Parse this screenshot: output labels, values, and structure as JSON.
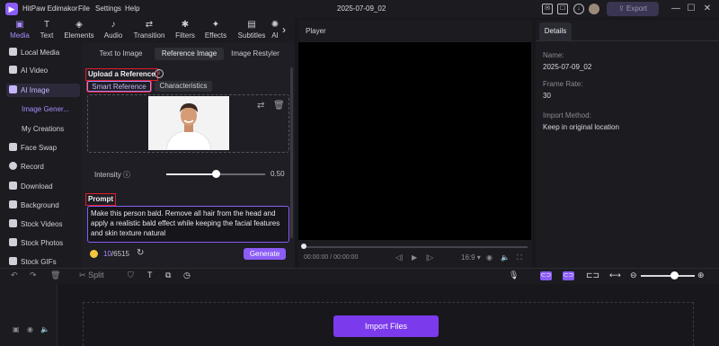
{
  "app": {
    "title": "HitPaw Edimakor",
    "menus": [
      "File",
      "Settings",
      "Help"
    ],
    "project_name": "2025-07-09_02",
    "export_label": "Export"
  },
  "toolbar": {
    "tools": [
      {
        "label": "Media",
        "icon": "media-icon"
      },
      {
        "label": "Text",
        "icon": "text-icon"
      },
      {
        "label": "Elements",
        "icon": "elements-icon"
      },
      {
        "label": "Audio",
        "icon": "audio-icon"
      },
      {
        "label": "Transition",
        "icon": "transition-icon"
      },
      {
        "label": "Filters",
        "icon": "filters-icon"
      },
      {
        "label": "Effects",
        "icon": "effects-icon"
      },
      {
        "label": "Subtitles",
        "icon": "subtitles-icon"
      },
      {
        "label": "AI",
        "icon": "ai-icon"
      }
    ]
  },
  "sidebar": {
    "items": [
      {
        "label": "Local Media"
      },
      {
        "label": "AI Video"
      },
      {
        "label": "AI Image"
      },
      {
        "label": "Face Swap"
      },
      {
        "label": "Record"
      },
      {
        "label": "Download"
      },
      {
        "label": "Background"
      },
      {
        "label": "Stock Videos"
      },
      {
        "label": "Stock Photos"
      },
      {
        "label": "Stock GIFs"
      }
    ],
    "sub_items": [
      {
        "label": "Image Gener..."
      },
      {
        "label": "My Creations"
      }
    ]
  },
  "panel": {
    "tabs": [
      "Text to Image",
      "Reference Image",
      "Image Restyler"
    ],
    "upload_title": "Upload a Reference",
    "chips": [
      "Smart Reference",
      "Characteristics"
    ],
    "intensity_label": "Intensity",
    "intensity_value": "0.50",
    "intensity_fraction": 0.5,
    "prompt_title": "Prompt",
    "prompt_text": "Make this person bald. Remove all hair from the head and apply a realistic bald effect while keeping the facial features and skin texture natural",
    "credits_used": "10",
    "credits_total": "/6515",
    "generate_label": "Generate"
  },
  "player": {
    "title": "Player",
    "time": "00:00:00 / 00:00:00",
    "ratio": "16:9"
  },
  "details": {
    "tab": "Details",
    "fields": [
      {
        "label": "Name:",
        "value": "2025-07-09_02"
      },
      {
        "label": "Frame Rate:",
        "value": "30"
      },
      {
        "label": "Import Method:",
        "value": "Keep in original location"
      }
    ]
  },
  "timeline": {
    "split_label": "Split",
    "import_label": "Import Files",
    "zoom_fraction": 0.62
  },
  "colors": {
    "accent": "#8b5cf6",
    "highlight_red": "#e11d2a",
    "background": "#17171c"
  }
}
